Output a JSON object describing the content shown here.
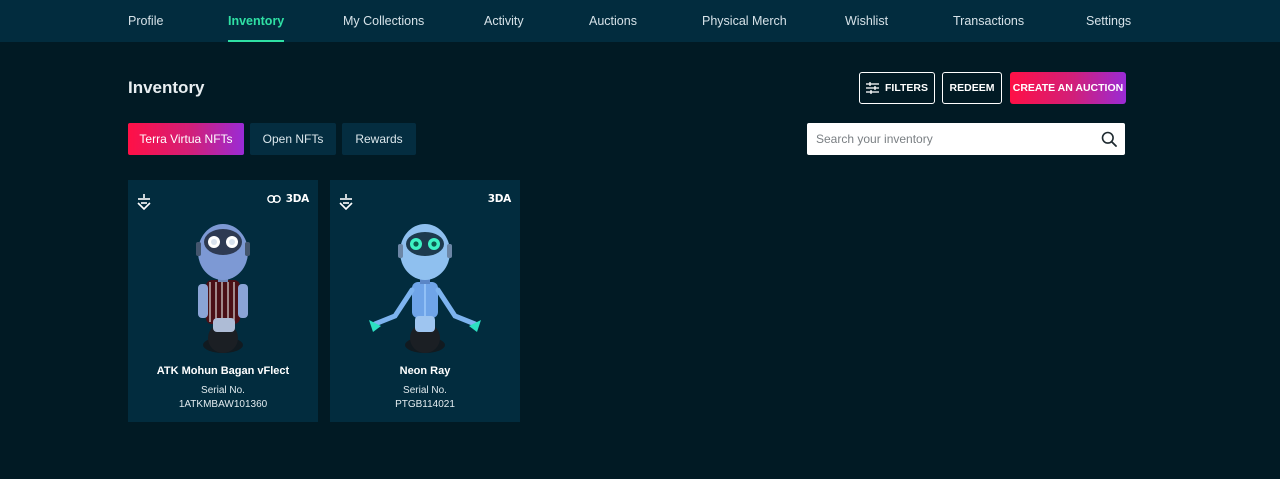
{
  "nav": {
    "items": [
      {
        "label": "Profile"
      },
      {
        "label": "Inventory"
      },
      {
        "label": "My Collections"
      },
      {
        "label": "Activity"
      },
      {
        "label": "Auctions"
      },
      {
        "label": "Physical Merch"
      },
      {
        "label": "Wishlist"
      },
      {
        "label": "Transactions"
      },
      {
        "label": "Settings"
      }
    ],
    "active": "Inventory"
  },
  "page": {
    "title": "Inventory"
  },
  "actions": {
    "filters_label": "FILTERS",
    "redeem_label": "REDEEM",
    "create_auction_label": "CREATE AN AUCTION"
  },
  "tabs": [
    {
      "label": "Terra Virtua NFTs",
      "active": true
    },
    {
      "label": "Open NFTs",
      "active": false
    },
    {
      "label": "Rewards",
      "active": false
    }
  ],
  "search": {
    "placeholder": "Search your inventory",
    "value": ""
  },
  "cards": [
    {
      "name": "ATK Mohun Bagan vFlect",
      "serial_label": "Serial No.",
      "serial_value": "1ATKMBAW101360",
      "badges": [
        "link-icon",
        "3DA"
      ]
    },
    {
      "name": "Neon Ray",
      "serial_label": "Serial No.",
      "serial_value": "PTGB114021",
      "badges": [
        "3DA"
      ]
    }
  ],
  "colors": {
    "background": "#011a24",
    "nav_background": "#022c3e",
    "accent_green": "#2fe0a4",
    "gradient_start": "#ff1046",
    "gradient_end": "#9a2bd6",
    "card_background": "#022c3e"
  }
}
